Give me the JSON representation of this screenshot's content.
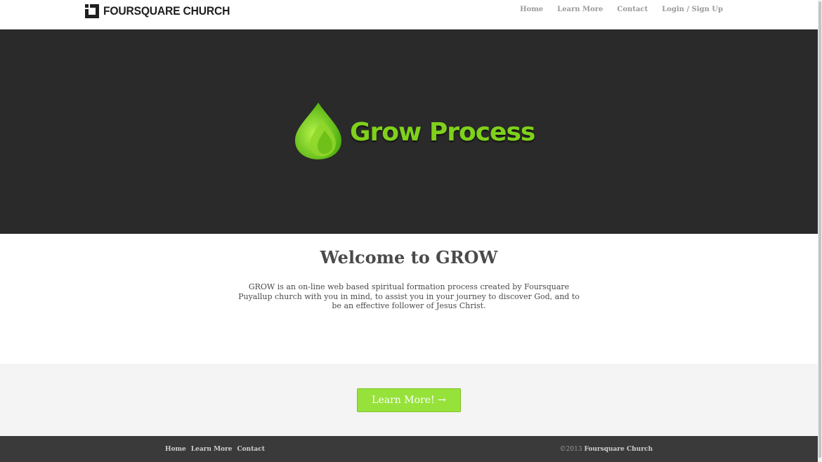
{
  "header": {
    "logo_text": "FOURSQUARE CHURCH",
    "nav": [
      "Home",
      "Learn More",
      "Contact",
      "Login / Sign Up"
    ]
  },
  "hero": {
    "title": "Grow Process",
    "accent_color": "#7fd11b",
    "icon": "green-drop-icon"
  },
  "welcome": {
    "heading": "Welcome to GROW",
    "body": "GROW is an on-line web based spiritual formation process created by Foursquare Puyallup church with you in mind, to assist you in your journey to discover God, and to be an effective follower of Jesus Christ."
  },
  "cta": {
    "button_label": "Learn More! →",
    "button_color": "#96e23a"
  },
  "footer": {
    "nav": [
      "Home",
      "Learn More",
      "Contact"
    ],
    "copyright_year": "©2013",
    "copyright_name": "Foursquare Church"
  }
}
